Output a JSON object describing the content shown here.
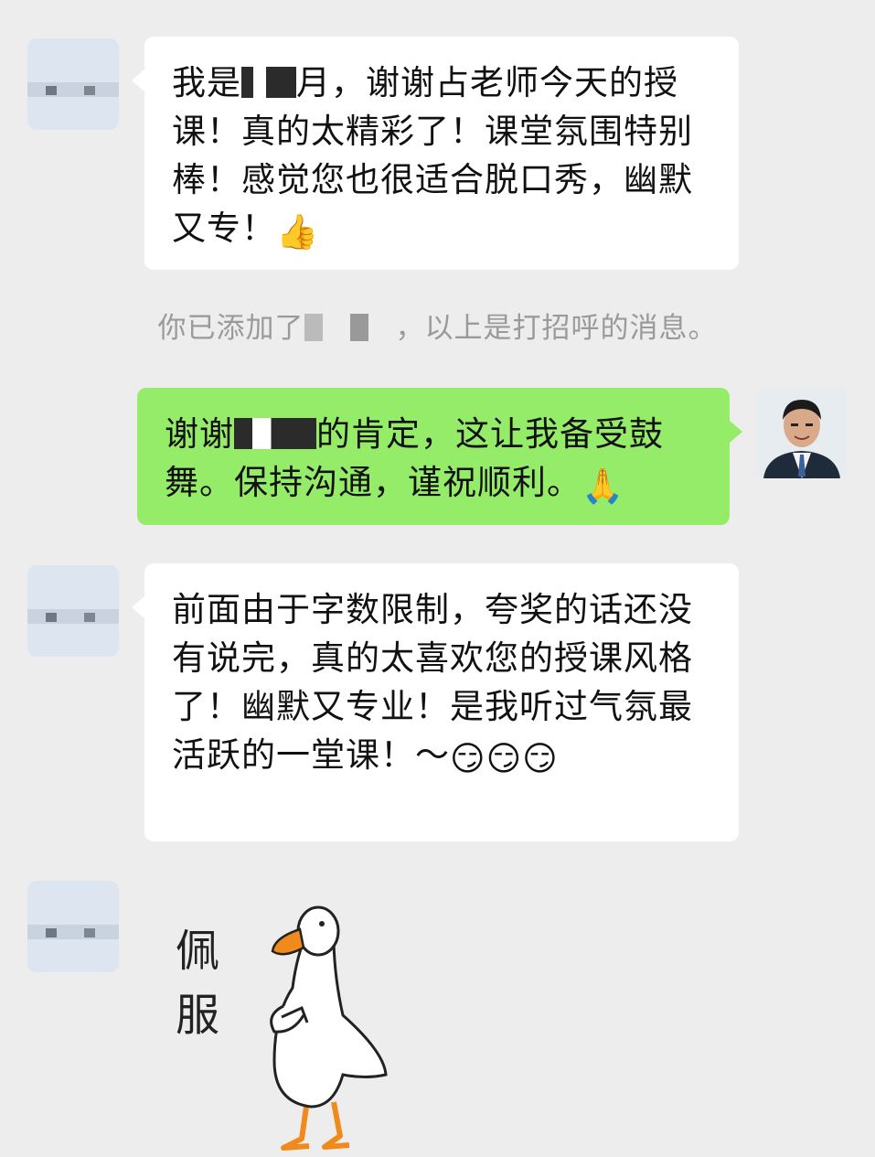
{
  "messages": {
    "m1": {
      "before": "我是",
      "after": "月，谢谢占老师今天的授课！真的太精彩了！课堂氛围特别棒！感觉您也很适合脱口秀，幽默又专！",
      "emoji": "👍"
    },
    "system": {
      "before": "你已添加了",
      "after": "，以上是打招呼的消息。"
    },
    "m2": {
      "before": "谢谢",
      "after": "的肯定，这让我备受鼓舞。保持沟通，谨祝顺利。",
      "emoji": "🙏"
    },
    "m3": {
      "text": "前面由于字数限制，夸奖的话还没有说完，真的太喜欢您的授课风格了！幽默又专业！是我听过气氛最活跃的一堂课！～",
      "emoji": "😏😏😏"
    },
    "sticker": {
      "line1": "佩",
      "line2": "服"
    }
  },
  "colors": {
    "background": "#ededed",
    "incoming": "#ffffff",
    "outgoing": "#95ec69",
    "system_text": "#9a9a9a"
  }
}
